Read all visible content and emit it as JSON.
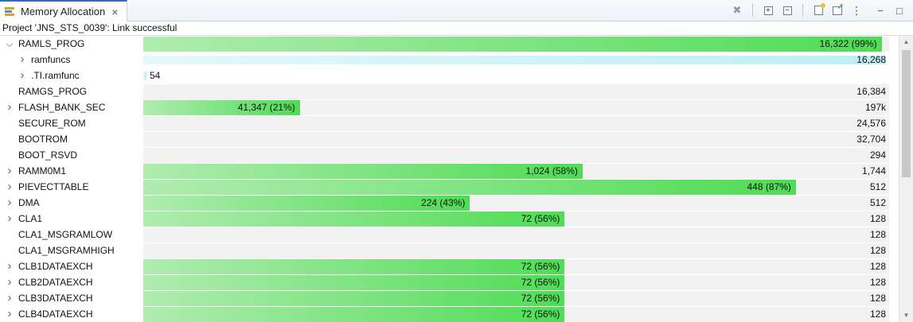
{
  "tab": {
    "title": "Memory Allocation",
    "close": "×"
  },
  "toolbar": {
    "remove": "✖",
    "expand_all": "+",
    "collapse_all": "−",
    "more": "⋮",
    "minimize": "−",
    "maximize": "□"
  },
  "status": "Project 'JNS_STS_0039': Link successful",
  "colors": {
    "bar_start": "#b0ecb0",
    "bar_end": "#4fdc54",
    "sub_bar": "#bdeef4",
    "track": "#f2f2f2"
  },
  "rows": [
    {
      "name": "RAMLS_PROG",
      "expander": "v",
      "level": 0,
      "fill_pct": 99,
      "fill_label": "16,322 (99%)",
      "total": ""
    },
    {
      "name": "ramfuncs",
      "expander": ">",
      "level": 1,
      "sub_pct": 99.6,
      "total": "16,268"
    },
    {
      "name": ".TI.ramfunc",
      "expander": ">",
      "level": 1,
      "sub_pct": 0.4,
      "outside": "54",
      "total": ""
    },
    {
      "name": "RAMGS_PROG",
      "expander": "",
      "level": 0,
      "fill_pct": 0,
      "fill_label": "",
      "total": "16,384"
    },
    {
      "name": "FLASH_BANK_SEC",
      "expander": ">",
      "level": 0,
      "fill_pct": 21,
      "fill_label": "41,347 (21%)",
      "total": "197k"
    },
    {
      "name": "SECURE_ROM",
      "expander": "",
      "level": 0,
      "fill_pct": 0,
      "fill_label": "",
      "total": "24,576"
    },
    {
      "name": "BOOTROM",
      "expander": "",
      "level": 0,
      "fill_pct": 0,
      "fill_label": "",
      "total": "32,704"
    },
    {
      "name": "BOOT_RSVD",
      "expander": "",
      "level": 0,
      "fill_pct": 0,
      "fill_label": "",
      "total": "294"
    },
    {
      "name": "RAMM0M1",
      "expander": ">",
      "level": 0,
      "fill_pct": 58.9,
      "fill_label": "1,024 (58%)",
      "total": "1,744"
    },
    {
      "name": "PIEVECTTABLE",
      "expander": ">",
      "level": 0,
      "fill_pct": 87.5,
      "fill_label": "448 (87%)",
      "total": "512"
    },
    {
      "name": "DMA",
      "expander": ">",
      "level": 0,
      "fill_pct": 43.8,
      "fill_label": "224 (43%)",
      "total": "512"
    },
    {
      "name": "CLA1",
      "expander": ">",
      "level": 0,
      "fill_pct": 56.5,
      "fill_label": "72 (56%)",
      "total": "128"
    },
    {
      "name": "CLA1_MSGRAMLOW",
      "expander": "",
      "level": 0,
      "fill_pct": 0,
      "fill_label": "",
      "total": "128"
    },
    {
      "name": "CLA1_MSGRAMHIGH",
      "expander": "",
      "level": 0,
      "fill_pct": 0,
      "fill_label": "",
      "total": "128"
    },
    {
      "name": "CLB1DATAEXCH",
      "expander": ">",
      "level": 0,
      "fill_pct": 56.5,
      "fill_label": "72 (56%)",
      "total": "128"
    },
    {
      "name": "CLB2DATAEXCH",
      "expander": ">",
      "level": 0,
      "fill_pct": 56.5,
      "fill_label": "72 (56%)",
      "total": "128"
    },
    {
      "name": "CLB3DATAEXCH",
      "expander": ">",
      "level": 0,
      "fill_pct": 56.5,
      "fill_label": "72 (56%)",
      "total": "128"
    },
    {
      "name": "CLB4DATAEXCH",
      "expander": ">",
      "level": 0,
      "fill_pct": 56.5,
      "fill_label": "72 (56%)",
      "total": "128"
    }
  ]
}
